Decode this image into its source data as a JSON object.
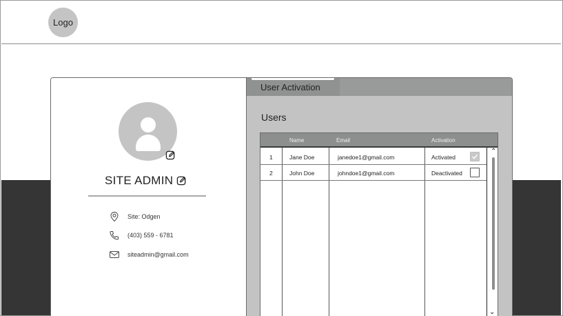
{
  "header": {
    "logo_text": "Logo"
  },
  "profile": {
    "name": "SITE ADMIN",
    "site": "Site: Odgen",
    "phone": "(403) 559 - 6781",
    "email": "siteadmin@gmail.com"
  },
  "panel": {
    "tab_label": "User Activation",
    "section_title": "Users",
    "table": {
      "columns": [
        "",
        "Name",
        "Email",
        "Activation"
      ],
      "rows": [
        {
          "num": "1",
          "name": "Jane Doe",
          "email": "janedoe1@gmail.com",
          "status": "Activated",
          "checked": true
        },
        {
          "num": "2",
          "name": "John Doe",
          "email": "johndoe1@gmail.com",
          "status": "Deactivated",
          "checked": false
        }
      ]
    }
  },
  "colors": {
    "dark_band": "#353535",
    "panel_bg": "#c3c3c3",
    "header_bg": "#8c8f8e",
    "avatar_bg": "#c4c4c4"
  }
}
